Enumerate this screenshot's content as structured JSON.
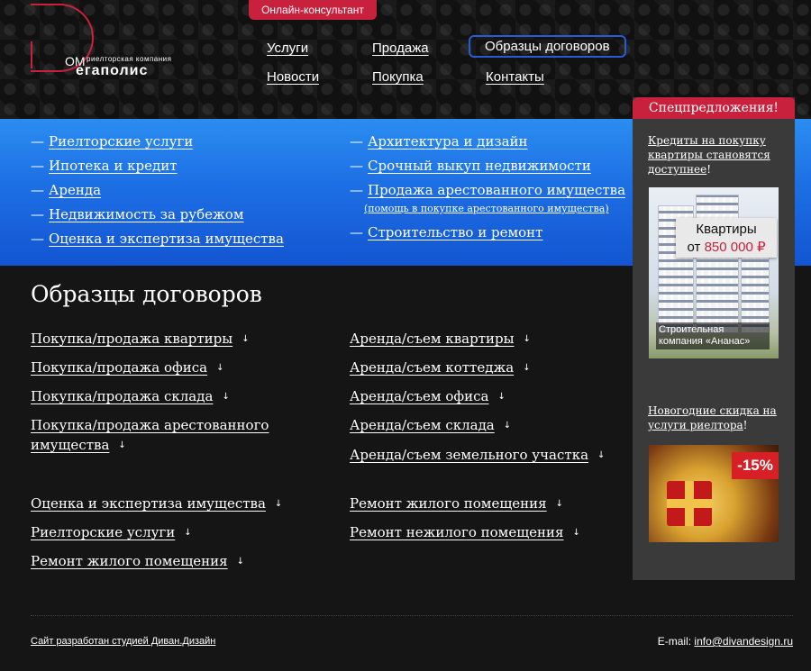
{
  "header": {
    "consultant_button": "Онлайн-консультант",
    "logo": {
      "top": "ОМ",
      "tagline": "риелторская компания",
      "main": "егаполис"
    },
    "nav": [
      "Услуги",
      "Продажа",
      "Образцы договоров",
      "Новости",
      "Покупка",
      "Контакты"
    ],
    "active_nav": "Образцы договоров"
  },
  "services_menu": {
    "left": [
      "Риелторские услуги",
      "Ипотека и кредит",
      "Аренда",
      "Недвижимость за рубежом",
      "Оценка и экспертиза имущества"
    ],
    "right": [
      "Архитектура и дизайн",
      "Срочный выкуп недвижимости",
      "Продажа арестованного имущества",
      "Строительство и ремонт"
    ],
    "right_note": "(помощь в покупке арестованного имущества)",
    "dash": "—"
  },
  "main": {
    "title": "Образцы договоров",
    "left": [
      "Покупка/продажа квартиры",
      "Покупка/продажа офиса",
      "Покупка/продажа склада",
      "Покупка/продажа арестованного",
      "имущества",
      "Оценка и экспертиза имущества",
      "Риелторские услуги",
      "Ремонт жилого помещения"
    ],
    "right": [
      "Аренда/съем квартиры",
      "Аренда/съем коттеджа",
      "Аренда/съем офиса",
      "Аренда/съем склада",
      "Аренда/съем земельного участка",
      "Ремонт жилого помещения",
      "Ремонт  нежилого помещения"
    ],
    "download_icon": "↓"
  },
  "sidebar": {
    "promo_label": "Спецпредложения!",
    "offer1": {
      "link": "Кредиты на покупку квартиры становятся доступнее",
      "tail": "!"
    },
    "ad1": {
      "line1": "Квартиры",
      "line2_prefix": "от ",
      "price": "850 000 ₽",
      "caption": "Строительная компания «Ананас»"
    },
    "offer2": {
      "link": "Новогодние скидка на услуги риелтора",
      "tail": "!"
    },
    "ad2": {
      "badge": "-15%"
    }
  },
  "footer": {
    "credit": "Сайт разработан студией Диван.Дизайн",
    "email_label": "E-mail: ",
    "email": "info@divandesign.ru"
  },
  "colors": {
    "accent": "#c8213d",
    "band": "#1d6fe4",
    "active_border": "#2a5bd7"
  }
}
